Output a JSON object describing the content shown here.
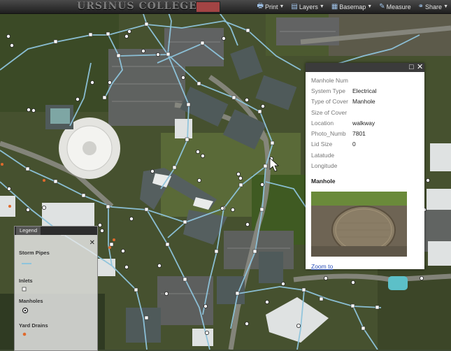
{
  "app_title": "URSINUS COLLEGE",
  "toolbar": {
    "items": [
      {
        "label": "Print",
        "icon": "printer-icon"
      },
      {
        "label": "Layers",
        "icon": "layers-icon"
      },
      {
        "label": "Basemap",
        "icon": "basemap-grid-icon"
      },
      {
        "label": "Measure",
        "icon": "ruler-icon"
      },
      {
        "label": "Share",
        "icon": "share-icon"
      }
    ]
  },
  "popup": {
    "fields": [
      {
        "key": "Manhole Num",
        "value": ""
      },
      {
        "key": "System Type",
        "value": "Electrical"
      },
      {
        "key": "Type of Cover",
        "value": "Manhole"
      },
      {
        "key": "Size of Cover",
        "value": ""
      },
      {
        "key": "Location",
        "value": "walkway"
      },
      {
        "key": "Photo_Numb",
        "value": "7801"
      },
      {
        "key": "Lid Size",
        "value": "0"
      },
      {
        "key": "Latatude",
        "value": ""
      },
      {
        "key": "Longitude",
        "value": ""
      }
    ],
    "section_title": "Manhole",
    "zoom_label": "Zoom to",
    "maximize_glyph": "□",
    "close_glyph": "✕"
  },
  "legend": {
    "tab_label": "Legend",
    "close_glyph": "✕",
    "items": [
      "Storm Pipes",
      "Inlets",
      "Manholes",
      "Yard Drains"
    ]
  },
  "colors": {
    "pipe": "#8ec4dc",
    "toolbar_bg": "#2a2a2a",
    "link": "#2a4fb8",
    "yard_drain": "#e06a2c"
  }
}
